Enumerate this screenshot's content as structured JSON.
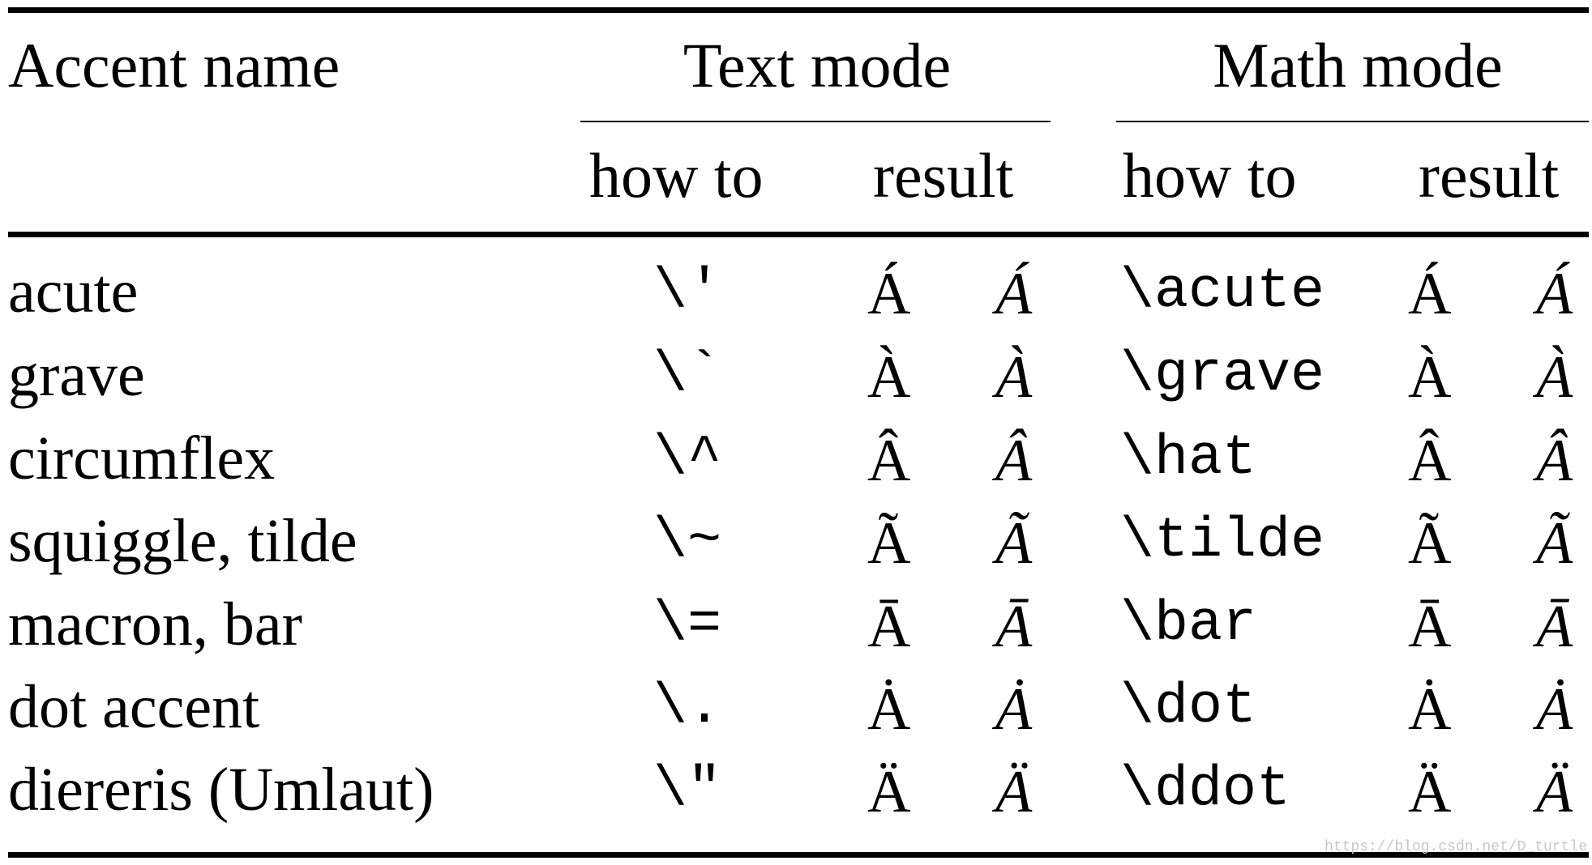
{
  "table": {
    "header": {
      "accent_name": "Accent name",
      "text_mode": "Text mode",
      "math_mode": "Math mode",
      "text_how_to": "how to",
      "text_result": "result",
      "math_how_to": "how to",
      "math_result": "result"
    },
    "rows": [
      {
        "name": "acute",
        "text_cmd": "\\'",
        "text_upright": "Á",
        "text_italic": "Á",
        "math_cmd": "\\acute",
        "math_upright": "Á",
        "math_italic": "Á"
      },
      {
        "name": "grave",
        "text_cmd": "\\`",
        "text_upright": "À",
        "text_italic": "À",
        "math_cmd": "\\grave",
        "math_upright": "À",
        "math_italic": "À"
      },
      {
        "name": "circumflex",
        "text_cmd": "\\^",
        "text_upright": "Â",
        "text_italic": "Â",
        "math_cmd": "\\hat",
        "math_upright": "Â",
        "math_italic": "Â"
      },
      {
        "name": "squiggle, tilde",
        "text_cmd": "\\~",
        "text_upright": "Ã",
        "text_italic": "Ã",
        "math_cmd": "\\tilde",
        "math_upright": "Ã",
        "math_italic": "Ã"
      },
      {
        "name": "macron, bar",
        "text_cmd": "\\=",
        "text_upright": "Ā",
        "text_italic": "Ā",
        "math_cmd": "\\bar",
        "math_upright": "Ā",
        "math_italic": "Ā"
      },
      {
        "name": "dot accent",
        "text_cmd": "\\.",
        "text_upright": "Ȧ",
        "text_italic": "Ȧ",
        "math_cmd": "\\dot",
        "math_upright": "Ȧ",
        "math_italic": "Ȧ"
      },
      {
        "name": "diereris (Umlaut)",
        "text_cmd": "\\\"",
        "text_upright": "Ä",
        "text_italic": "Ä",
        "math_cmd": "\\ddot",
        "math_upright": "Ä",
        "math_italic": "Ä"
      }
    ]
  },
  "watermark": "https://blog.csdn.net/D_turtle"
}
